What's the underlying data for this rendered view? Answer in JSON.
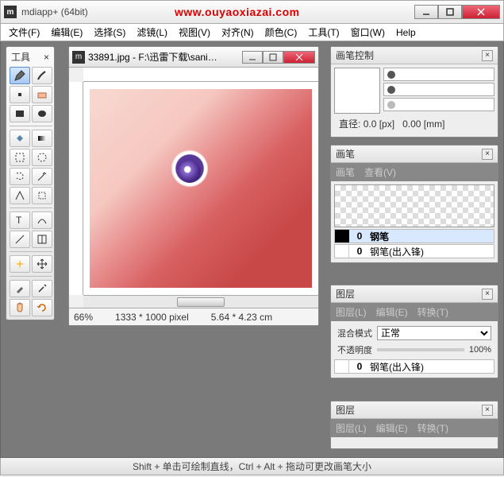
{
  "window": {
    "title": "mdiapp+ (64bit)",
    "watermark": "www.ouyaoxiazai.com"
  },
  "menu": {
    "items": [
      "文件(F)",
      "编辑(E)",
      "选择(S)",
      "滤镜(L)",
      "视图(V)",
      "对齐(N)",
      "颜色(C)",
      "工具(T)",
      "窗口(W)",
      "Help"
    ]
  },
  "tools_panel": {
    "title": "工具"
  },
  "document": {
    "title": "33891.jpg - F:\\迅雷下载\\sani…",
    "zoom": "66%",
    "dims_px": "1333 * 1000 pixel",
    "dims_cm": "5.64 * 4.23 cm"
  },
  "brush_control": {
    "title": "画笔控制",
    "diameter_label": "直径:",
    "diameter_px": "0.0 [px]",
    "diameter_mm": "0.00 [mm]"
  },
  "brush_panel": {
    "title": "画笔",
    "sub_menu": [
      "画笔",
      "查看(V)"
    ],
    "items": [
      {
        "swatch": "black",
        "num": "0",
        "name": "钢笔",
        "selected": true
      },
      {
        "swatch": "white",
        "num": "0",
        "name": "钢笔(出入锋)",
        "selected": false
      }
    ]
  },
  "layer_panel": {
    "title": "图层",
    "sub_menu": [
      "图层(L)",
      "编辑(E)",
      "转换(T)"
    ],
    "blend_label": "混合模式",
    "blend_value": "正常",
    "opacity_label": "不透明度",
    "opacity_value": "100%",
    "items": [
      {
        "swatch": "white",
        "num": "0",
        "name": "钢笔(出入锋)"
      }
    ]
  },
  "layer_panel2": {
    "title": "图层",
    "sub_menu": [
      "图层(L)",
      "编辑(E)",
      "转换(T)"
    ]
  },
  "statusbar": {
    "hint": "Shift + 单击可绘制直线，Ctrl + Alt + 拖动可更改画笔大小"
  }
}
